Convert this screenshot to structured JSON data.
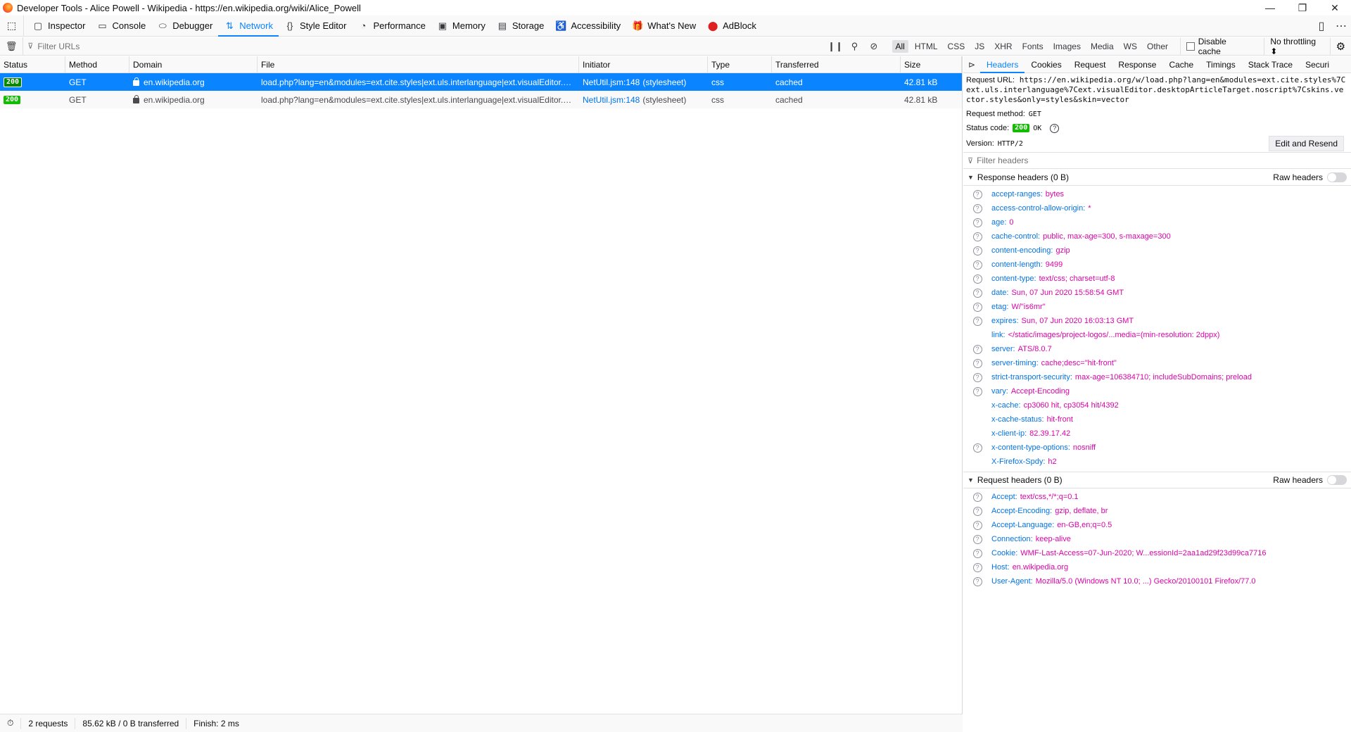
{
  "window": {
    "title": "Developer Tools - Alice Powell - Wikipedia - https://en.wikipedia.org/wiki/Alice_Powell"
  },
  "toolbox": {
    "tabs": [
      {
        "label": "Inspector",
        "icon": "inspector-icon",
        "glyph": "▢"
      },
      {
        "label": "Console",
        "icon": "console-icon",
        "glyph": "▭"
      },
      {
        "label": "Debugger",
        "icon": "debugger-icon",
        "glyph": "⬭"
      },
      {
        "label": "Network",
        "icon": "network-icon",
        "glyph": "⇅",
        "selected": true
      },
      {
        "label": "Style Editor",
        "icon": "style-editor-icon",
        "glyph": "{}"
      },
      {
        "label": "Performance",
        "icon": "performance-icon",
        "glyph": "◔"
      },
      {
        "label": "Memory",
        "icon": "memory-icon",
        "glyph": "▣"
      },
      {
        "label": "Storage",
        "icon": "storage-icon",
        "glyph": "▤"
      },
      {
        "label": "Accessibility",
        "icon": "accessibility-icon",
        "glyph": "♿"
      },
      {
        "label": "What's New",
        "icon": "whats-new-icon",
        "glyph": "🎁"
      },
      {
        "label": "AdBlock",
        "icon": "adblock-icon",
        "glyph": "⬤"
      }
    ]
  },
  "filter": {
    "placeholder": "Filter URLs",
    "types": [
      "All",
      "HTML",
      "CSS",
      "JS",
      "XHR",
      "Fonts",
      "Images",
      "Media",
      "WS",
      "Other"
    ],
    "selected_type": "All",
    "disable_cache_label": "Disable cache",
    "throttling_label": "No throttling ⬍"
  },
  "columns": [
    "Status",
    "Method",
    "Domain",
    "File",
    "Initiator",
    "Type",
    "Transferred",
    "Size"
  ],
  "requests": [
    {
      "status": "200",
      "method": "GET",
      "domain": "en.wikipedia.org",
      "file": "load.php?lang=en&modules=ext.cite.styles|ext.uls.interlanguage|ext.visualEditor.desktopArticleTarget.noscript|skins.vector.styles&only=styles&skin=vector",
      "initiator_link": "NetUtil.jsm:148",
      "initiator_cause": "(stylesheet)",
      "type": "css",
      "transferred": "cached",
      "size": "42.81 kB",
      "selected": true
    },
    {
      "status": "200",
      "method": "GET",
      "domain": "en.wikipedia.org",
      "file": "load.php?lang=en&modules=ext.cite.styles|ext.uls.interlanguage|ext.visualEditor.desktopArticleTarget.noscript|skins.vector.styles&only=styles&skin=vector",
      "initiator_link": "NetUtil.jsm:148",
      "initiator_cause": "(stylesheet)",
      "type": "css",
      "transferred": "cached",
      "size": "42.81 kB",
      "selected": false
    }
  ],
  "statusbar": {
    "requests": "2 requests",
    "size": "85.62 kB / 0 B transferred",
    "finish": "Finish: 2 ms"
  },
  "sidepanel": {
    "tabs": [
      "Headers",
      "Cookies",
      "Request",
      "Response",
      "Cache",
      "Timings",
      "Stack Trace",
      "Securi"
    ],
    "selected_tab": "Headers",
    "request_url_label": "Request URL:",
    "request_url": "https://en.wikipedia.org/w/load.php?lang=en&modules=ext.cite.styles%7Cext.uls.interlanguage%7Cext.visualEditor.desktopArticleTarget.noscript%7Cskins.vector.styles&only=styles&skin=vector",
    "request_method_label": "Request method:",
    "request_method": "GET",
    "status_code_label": "Status code:",
    "status_code": "200",
    "status_text": "OK",
    "version_label": "Version:",
    "version": "HTTP/2",
    "edit_resend_label": "Edit and Resend",
    "filter_headers_placeholder": "Filter headers",
    "raw_headers_label": "Raw headers",
    "response_headers_title": "Response headers (0 B)",
    "request_headers_title": "Request headers (0 B)",
    "response_headers": [
      {
        "name": "accept-ranges:",
        "value": "bytes",
        "help": true
      },
      {
        "name": "access-control-allow-origin:",
        "value": "*",
        "help": true
      },
      {
        "name": "age:",
        "value": "0",
        "help": true
      },
      {
        "name": "cache-control:",
        "value": "public, max-age=300, s-maxage=300",
        "help": true
      },
      {
        "name": "content-encoding:",
        "value": "gzip",
        "help": true
      },
      {
        "name": "content-length:",
        "value": "9499",
        "help": true
      },
      {
        "name": "content-type:",
        "value": "text/css; charset=utf-8",
        "help": true
      },
      {
        "name": "date:",
        "value": "Sun, 07 Jun 2020 15:58:54 GMT",
        "help": true
      },
      {
        "name": "etag:",
        "value": "W/\"is6mr\"",
        "help": true
      },
      {
        "name": "expires:",
        "value": "Sun, 07 Jun 2020 16:03:13 GMT",
        "help": true
      },
      {
        "name": "link:",
        "value": "</static/images/project-logos/...media=(min-resolution: 2dppx)",
        "help": false
      },
      {
        "name": "server:",
        "value": "ATS/8.0.7",
        "help": true
      },
      {
        "name": "server-timing:",
        "value": "cache;desc=\"hit-front\"",
        "help": true
      },
      {
        "name": "strict-transport-security:",
        "value": "max-age=106384710; includeSubDomains; preload",
        "help": true
      },
      {
        "name": "vary:",
        "value": "Accept-Encoding",
        "help": true
      },
      {
        "name": "x-cache:",
        "value": "cp3060 hit, cp3054 hit/4392",
        "help": false
      },
      {
        "name": "x-cache-status:",
        "value": "hit-front",
        "help": false
      },
      {
        "name": "x-client-ip:",
        "value": "82.39.17.42",
        "help": false
      },
      {
        "name": "x-content-type-options:",
        "value": "nosniff",
        "help": true
      },
      {
        "name": "X-Firefox-Spdy:",
        "value": "h2",
        "help": false
      }
    ],
    "request_headers": [
      {
        "name": "Accept:",
        "value": "text/css,*/*;q=0.1",
        "help": true
      },
      {
        "name": "Accept-Encoding:",
        "value": "gzip, deflate, br",
        "help": true
      },
      {
        "name": "Accept-Language:",
        "value": "en-GB,en;q=0.5",
        "help": true
      },
      {
        "name": "Connection:",
        "value": "keep-alive",
        "help": true
      },
      {
        "name": "Cookie:",
        "value": "WMF-Last-Access=07-Jun-2020; W...essionId=2aa1ad29f23d99ca7716",
        "help": true
      },
      {
        "name": "Host:",
        "value": "en.wikipedia.org",
        "help": true
      },
      {
        "name": "User-Agent:",
        "value": "Mozilla/5.0 (Windows NT 10.0; ...) Gecko/20100101 Firefox/77.0",
        "help": true
      }
    ]
  }
}
